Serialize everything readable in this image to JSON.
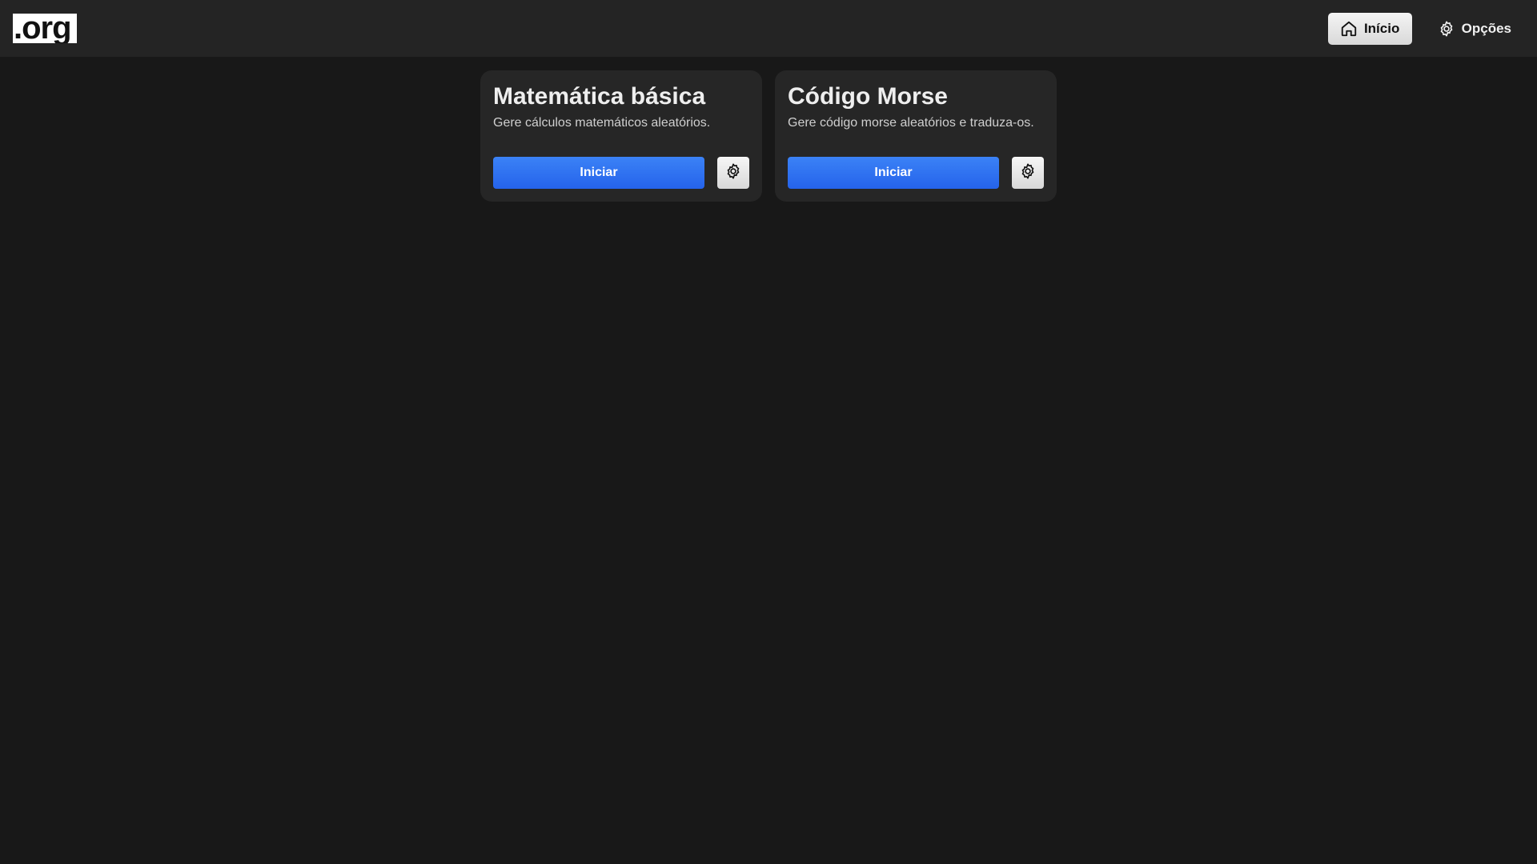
{
  "header": {
    "logo_text": ".org",
    "nav": {
      "home_label": "Início",
      "options_label": "Opções"
    }
  },
  "cards": [
    {
      "title": "Matemática básica",
      "description": "Gere cálculos matemáticos aleatórios.",
      "start_label": "Iniciar"
    },
    {
      "title": "Código Morse",
      "description": "Gere código morse aleatórios e traduza-os.",
      "start_label": "Iniciar"
    }
  ],
  "colors": {
    "background": "#181818",
    "topbar": "#242424",
    "card": "#262626",
    "accent": "#2563eb"
  },
  "icons": {
    "home": "home-icon",
    "options": "gear-icon",
    "card_settings": "gear-icon"
  }
}
